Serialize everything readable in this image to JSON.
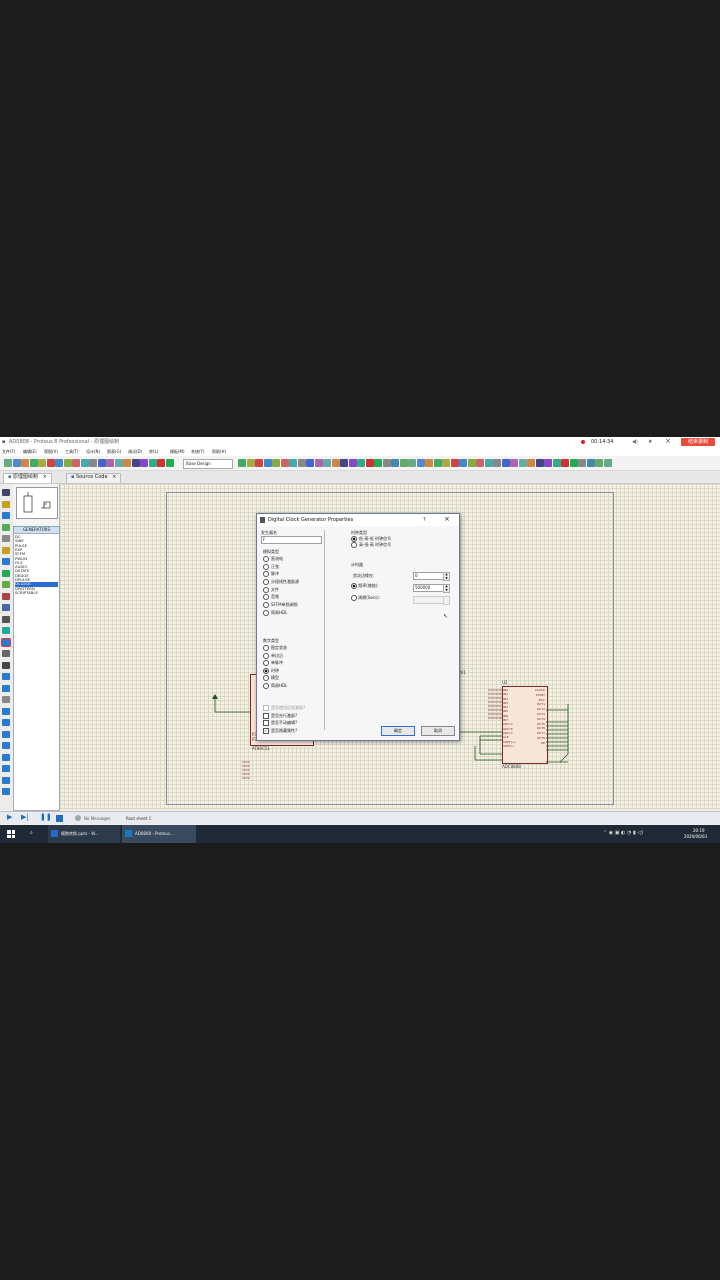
{
  "window": {
    "title": "AD0808 - Proteus 8 Professional - 原理图绘制",
    "timer": "00:14:34",
    "record_button": "结束录制"
  },
  "menu": [
    "文件(F)",
    "编辑(E)",
    "视图(V)",
    "工具(T)",
    "设计(N)",
    "图表(G)",
    "调试(D)",
    "库(L)",
    "模板(M)",
    "系统(Y)",
    "帮助(H)"
  ],
  "toolbar": {
    "design_select": "Base Design"
  },
  "tabs": [
    {
      "label": "原理图绘制"
    },
    {
      "label": "Source Code"
    }
  ],
  "device_panel": {
    "header": "GENERATORS",
    "items": [
      "DC",
      "SINE",
      "PULSE",
      "EXP",
      "SFFM",
      "PWLIN",
      "FILE",
      "AUDIO",
      "DSTATE",
      "DEDGE",
      "DPULSE",
      "DCLOCK",
      "DPATTERN",
      "SCRIPTABLE"
    ],
    "selected": "DCLOCK"
  },
  "schematic": {
    "chip_u2_ref": "U2",
    "chip_u2_label": "ADC0808",
    "chip_u1_label": "AT89C51",
    "rv1_label": "RV1",
    "u2_left_pins": [
      "IN0",
      "IN1",
      "IN2",
      "IN3",
      "IN4",
      "IN5",
      "IN6",
      "IN7",
      "ADD A",
      "ADD B",
      "ADD C",
      "ALE",
      "VREF(+)",
      "VREF(-)"
    ],
    "u2_right_pins": [
      "CLOCK",
      "START",
      "EOC",
      "OUT1",
      "OUT2",
      "OUT3",
      "OUT4",
      "OUT5",
      "OUT6",
      "OUT7",
      "OUT8",
      "OE"
    ],
    "u1_bottom_pins": [
      "P3.6",
      "P3.7"
    ],
    "u1_bottom_right_pins": [
      "P2.6/A14",
      "P2.7/A15"
    ]
  },
  "dialog": {
    "title": "Digital Clock Generator Properties",
    "help": "?",
    "close": "×",
    "name_label": "发生器名",
    "name_value": "F",
    "analog_types_header": "模拟类型",
    "analog_types": [
      "直流电",
      "正弦",
      "脉冲",
      "分段线性激励源",
      "文件",
      "音频",
      "SFFM单频调频",
      "简易HDL"
    ],
    "digital_types_header": "数字类型",
    "digital_types": [
      "稳定状态",
      "单边沿",
      "单脉冲",
      "时钟",
      "模型",
      "简易HDL"
    ],
    "digital_selected": "时钟",
    "options": [
      {
        "label": "是否使用远程激励?",
        "checked": false,
        "disabled": true
      },
      {
        "label": "是否先行激励?",
        "checked": false,
        "disabled": false
      },
      {
        "label": "是否手动编辑?",
        "checked": false,
        "disabled": false
      },
      {
        "label": "是否隐藏属性?",
        "checked": true,
        "disabled": false
      }
    ],
    "clock_type_header": "时钟类型",
    "clock_types": [
      "低-高-低 时钟信号",
      "高-低-高 时钟信号"
    ],
    "clock_selected": "低-高-低 时钟信号",
    "timing_header": "计时器",
    "first_edge_label": "首次边缘在:",
    "first_edge_value": "0",
    "frequency_label": "频率(赫兹):",
    "frequency_value": "500000",
    "period_label": "周期(Secs):",
    "period_value": "",
    "timing_selected": "频率(赫兹):",
    "ok": "确定",
    "cancel": "取消"
  },
  "statusbar": {
    "messages": "No Messages",
    "sheet": "Root sheet 1"
  },
  "taskbar": {
    "apps": [
      "模数转换.pptx - W...",
      "AD0808 - Proteus..."
    ],
    "time": "20:19",
    "date": "2020/06/03"
  }
}
